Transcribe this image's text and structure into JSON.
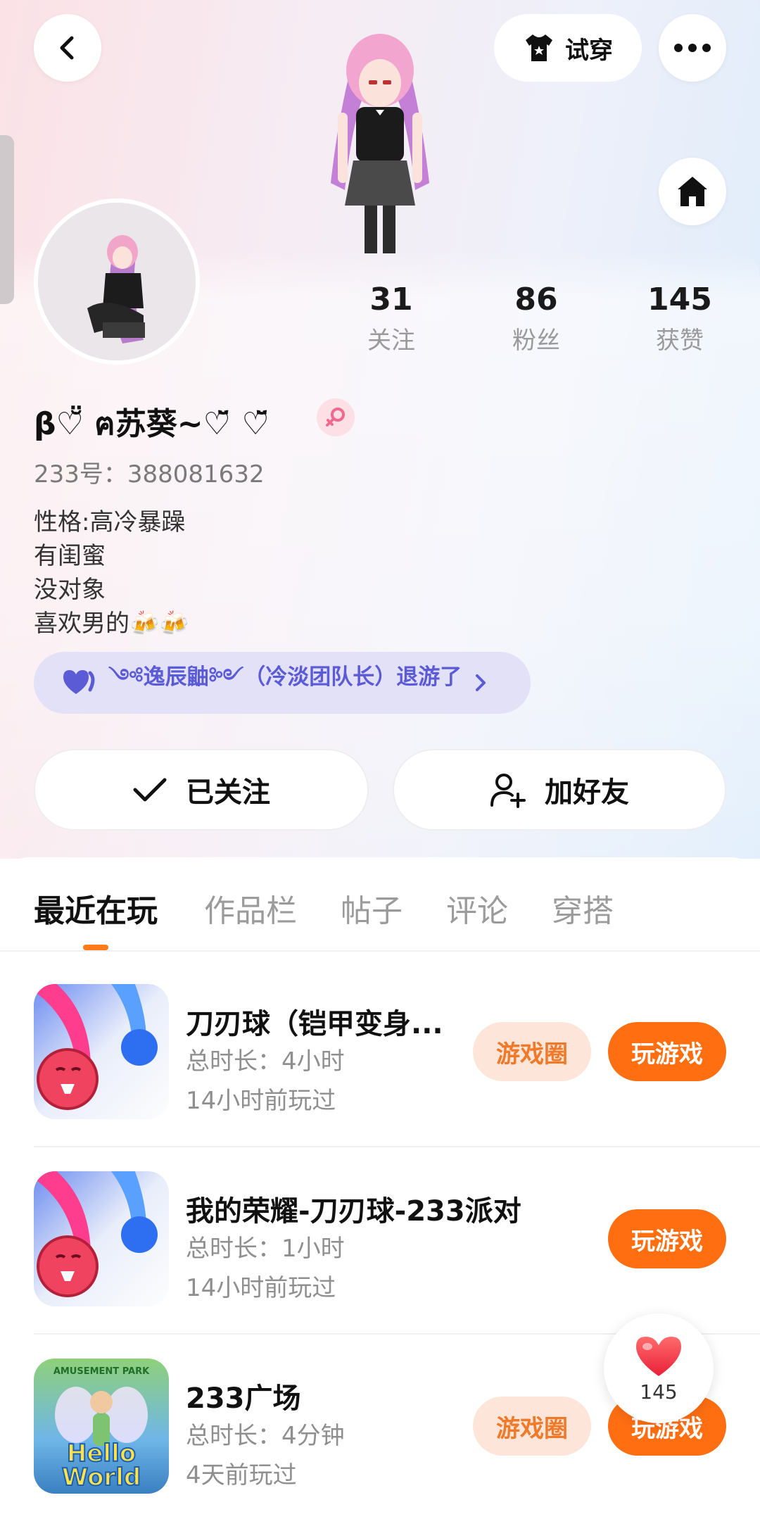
{
  "header": {
    "tryon_label": "试穿"
  },
  "stats": [
    {
      "value": "31",
      "label": "关注"
    },
    {
      "value": "86",
      "label": "粉丝"
    },
    {
      "value": "145",
      "label": "获赞"
    }
  ],
  "profile": {
    "nickname": "β♡̆̈ ฅ苏葵~♡̆̈ ♡̆̈",
    "id_text": "233号：388081632",
    "bio": [
      "性格:高冷暴躁",
      "有闺蜜",
      "没对象",
      "喜欢男的🍻🍻"
    ]
  },
  "team_banner": {
    "text": "༺逸辰鼬༻（冷淡团队长）退游了"
  },
  "actions": {
    "followed_label": "已关注",
    "add_friend_label": "加好友"
  },
  "tabs": [
    {
      "label": "最近在玩",
      "active": true
    },
    {
      "label": "作品栏",
      "active": false
    },
    {
      "label": "帖子",
      "active": false
    },
    {
      "label": "评论",
      "active": false
    },
    {
      "label": "穿搭",
      "active": false
    }
  ],
  "games": [
    {
      "title": "刀刃球（铠甲变身...",
      "duration": "总时长：4小时",
      "last_played": "14小时前玩过",
      "circle_label": "游戏圈",
      "play_label": "玩游戏"
    },
    {
      "title": "我的荣耀-刀刃球-233派对",
      "duration": "总时长：1小时",
      "last_played": "14小时前玩过",
      "play_label": "玩游戏"
    },
    {
      "title": "233广场",
      "duration": "总时长：4分钟",
      "last_played": "4天前玩过",
      "circle_label": "游戏圈",
      "play_label": "玩游戏",
      "icon_text_1": "Hello",
      "icon_text_2": "World",
      "icon_text_top": "AMUSEMENT PARK"
    }
  ],
  "like_float": {
    "count": "145"
  },
  "colors": {
    "accent_orange": "#ff6f12",
    "gamecircle_bg": "#fde6d9",
    "banner_text": "#5b5bd6"
  }
}
